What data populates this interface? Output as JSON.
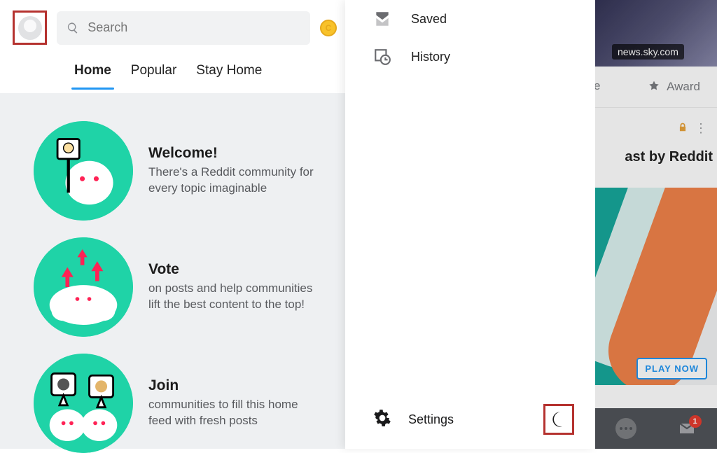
{
  "header": {
    "search_placeholder": "Search"
  },
  "tabs": {
    "home": "Home",
    "popular": "Popular",
    "stay_home": "Stay Home"
  },
  "feed": {
    "welcome": {
      "title": "Welcome!",
      "body": "There's a Reddit community for every topic imaginable"
    },
    "vote": {
      "title": "Vote",
      "body": "on posts and help communities lift the best content to the top!"
    },
    "join": {
      "title": "Join",
      "body": "communities to fill this home feed with fresh posts"
    }
  },
  "drawer": {
    "saved": "Saved",
    "history": "History",
    "settings": "Settings"
  },
  "backdrop": {
    "domain_pill": "news.sky.com",
    "partial_share_glyph": "e",
    "award_label": "Award",
    "partial_title": "ast by Reddit",
    "play_label": "PLAY NOW",
    "inbox_badge": "1"
  }
}
